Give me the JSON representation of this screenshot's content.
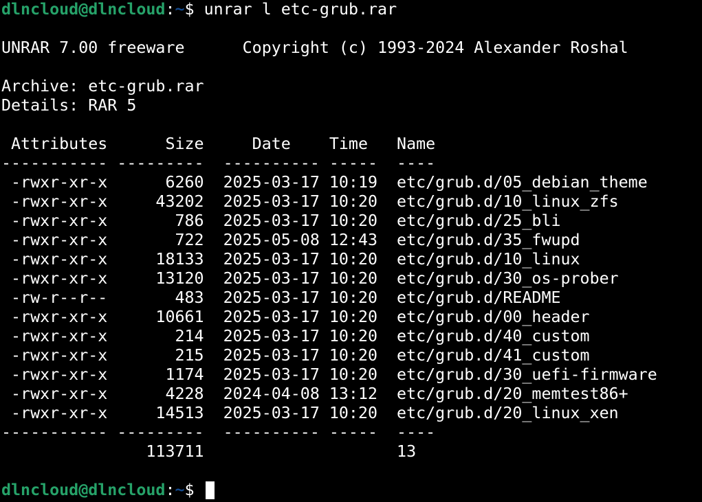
{
  "prompt": {
    "user_host": "dlncloud@dlncloud",
    "colon": ":",
    "path": "~",
    "symbol": "$ "
  },
  "command": "unrar l etc-grub.rar",
  "banner": "UNRAR 7.00 freeware      Copyright (c) 1993-2024 Alexander Roshal",
  "archive_line": "Archive: etc-grub.rar",
  "details_line": "Details: RAR 5",
  "table": {
    "header": " Attributes      Size     Date    Time   Name",
    "separator": "----------- ---------  ---------- -----  ----",
    "rows": [
      " -rwxr-xr-x      6260  2025-03-17 10:19  etc/grub.d/05_debian_theme",
      " -rwxr-xr-x     43202  2025-03-17 10:20  etc/grub.d/10_linux_zfs",
      " -rwxr-xr-x       786  2025-03-17 10:20  etc/grub.d/25_bli",
      " -rwxr-xr-x       722  2025-05-08 12:43  etc/grub.d/35_fwupd",
      " -rwxr-xr-x     18133  2025-03-17 10:20  etc/grub.d/10_linux",
      " -rwxr-xr-x     13120  2025-03-17 10:20  etc/grub.d/30_os-prober",
      " -rw-r--r--       483  2025-03-17 10:20  etc/grub.d/README",
      " -rwxr-xr-x     10661  2025-03-17 10:20  etc/grub.d/00_header",
      " -rwxr-xr-x       214  2025-03-17 10:20  etc/grub.d/40_custom",
      " -rwxr-xr-x       215  2025-03-17 10:20  etc/grub.d/41_custom",
      " -rwxr-xr-x      1174  2025-03-17 10:20  etc/grub.d/30_uefi-firmware",
      " -rwxr-xr-x      4228  2024-04-08 13:12  etc/grub.d/20_memtest86+",
      " -rwxr-xr-x     14513  2025-03-17 10:20  etc/grub.d/20_linux_xen"
    ],
    "footer_separator": "----------- ---------  ---------- -----  ----",
    "totals": "               113711                    13"
  },
  "colors": {
    "background": "#000000",
    "foreground": "#ffffff",
    "prompt_user": "#26a269",
    "prompt_path": "#12488b"
  }
}
